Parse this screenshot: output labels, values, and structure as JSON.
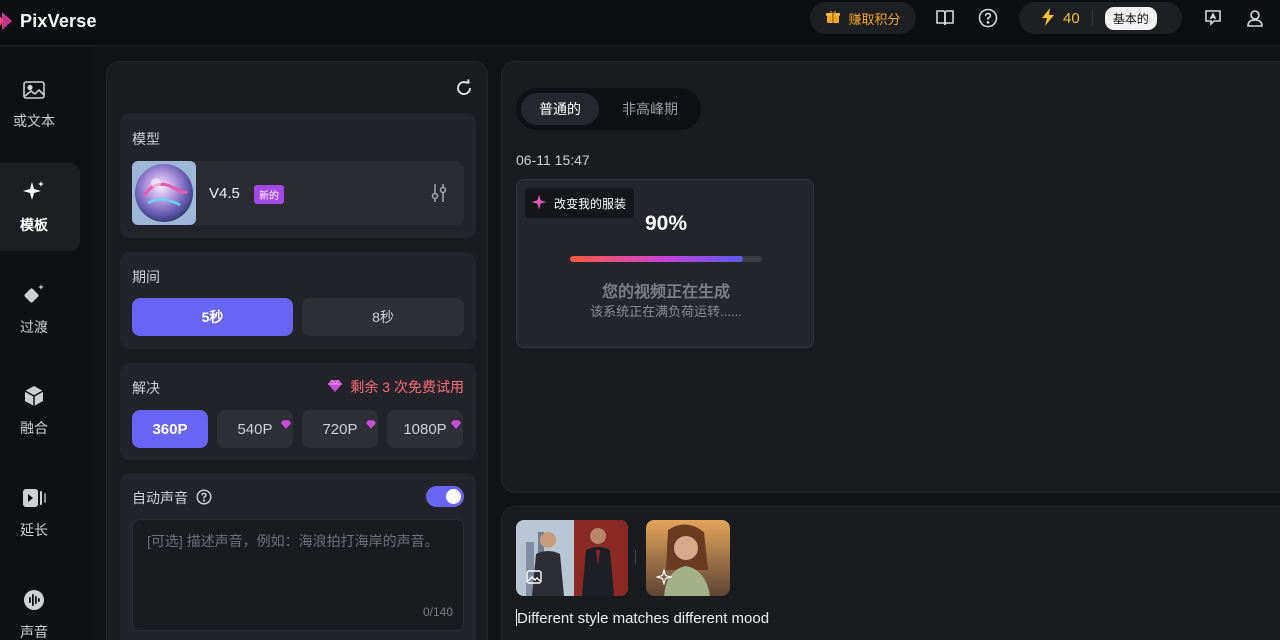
{
  "app": {
    "name": "PixVerse"
  },
  "header": {
    "earn_label": "赚取积分",
    "credits": "40",
    "plan": "基本的",
    "icons": [
      "gift-icon",
      "book-icon",
      "help-icon",
      "lightning-icon",
      "feedback-icon",
      "user-icon"
    ]
  },
  "rail": {
    "items": [
      {
        "label": "或文本",
        "icon": "image-icon"
      },
      {
        "label": "模板",
        "icon": "sparkle-icon",
        "active": true
      },
      {
        "label": "过渡",
        "icon": "transition-icon"
      },
      {
        "label": "融合",
        "icon": "cube-icon"
      },
      {
        "label": "延长",
        "icon": "extend-icon"
      },
      {
        "label": "声音",
        "icon": "sound-icon"
      }
    ]
  },
  "settings": {
    "model": {
      "title": "模型",
      "name": "V4.5",
      "badge": "新的"
    },
    "duration": {
      "title": "期间",
      "options": [
        "5秒",
        "8秒"
      ],
      "selected": "5秒"
    },
    "resolution": {
      "title": "解决",
      "trial": "剩余 3 次免费试用",
      "options": [
        "360P",
        "540P",
        "720P",
        "1080P"
      ],
      "selected": "360P"
    },
    "audio": {
      "title": "自动声音",
      "enabled": true,
      "placeholder": "[可选] 描述声音，例如：海浪拍打海岸的声音。",
      "counter": "0/140"
    }
  },
  "main": {
    "tabs": [
      "普通的",
      "非高峰期"
    ],
    "selected_tab": "普通的",
    "timestamp": "06-11 15:47",
    "generation": {
      "tag": "改变我的服装",
      "percent_label": "90%",
      "progress": 0.9,
      "title": "您的视频正在生成",
      "subtitle": "该系统正在满负荷运转......"
    }
  },
  "prompt": {
    "text": "Different style matches different mood"
  },
  "colors": {
    "accent": "#6a64f5",
    "trial": "#ff6a7a",
    "credits": "#f4c430",
    "earn": "#f4a623"
  }
}
